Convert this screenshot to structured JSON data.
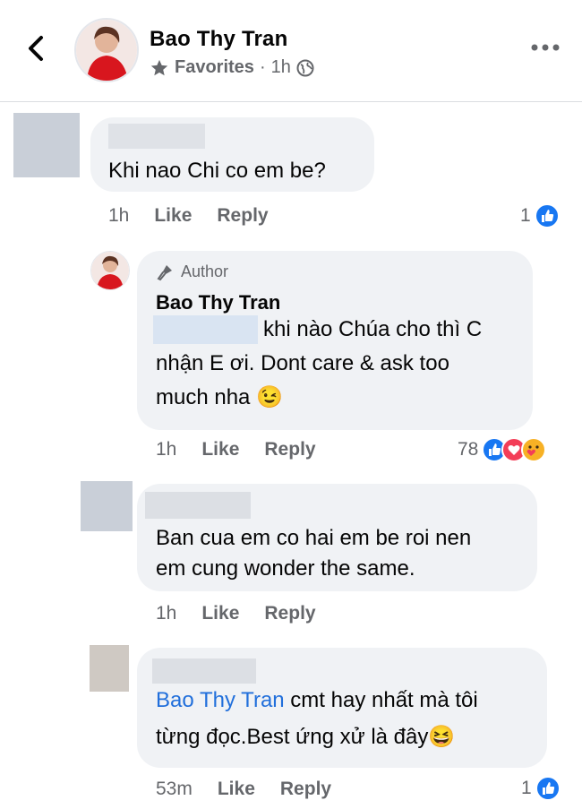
{
  "header": {
    "page_name": "Bao Thy Tran",
    "audience": "Favorites",
    "separator": "·",
    "time": "1h"
  },
  "comments": [
    {
      "text": "Khi nao Chi co em be?",
      "time": "1h",
      "like_label": "Like",
      "reply_label": "Reply",
      "reaction_count": "1",
      "reactions": [
        "like-icon"
      ]
    },
    {
      "badge": "Author",
      "author": "Bao Thy Tran",
      "lines": [
        "khi nào Chúa cho thì C",
        "nhận E ơi. Dont care & ask too",
        "much nha 😉"
      ],
      "time": "1h",
      "like_label": "Like",
      "reply_label": "Reply",
      "reaction_count": "78",
      "reactions": [
        "like-icon",
        "love-icon",
        "care-icon"
      ]
    },
    {
      "lines": [
        "Ban cua em co hai em be roi nen",
        "em cung wonder the same."
      ],
      "time": "1h",
      "like_label": "Like",
      "reply_label": "Reply"
    },
    {
      "mention": "Bao Thy Tran",
      "line1_rest": " cmt hay nhất mà tôi",
      "line2": "từng đọc.Best ứng xử là đây😆",
      "time": "53m",
      "like_label": "Like",
      "reply_label": "Reply",
      "reaction_count": "1",
      "reactions": [
        "like-icon"
      ]
    }
  ],
  "colors": {
    "bubble": "#f0f2f5",
    "secondary_text": "#65676b",
    "mention": "#216fdb",
    "like_blue": "#1877f2",
    "love_red": "#f33e58"
  }
}
